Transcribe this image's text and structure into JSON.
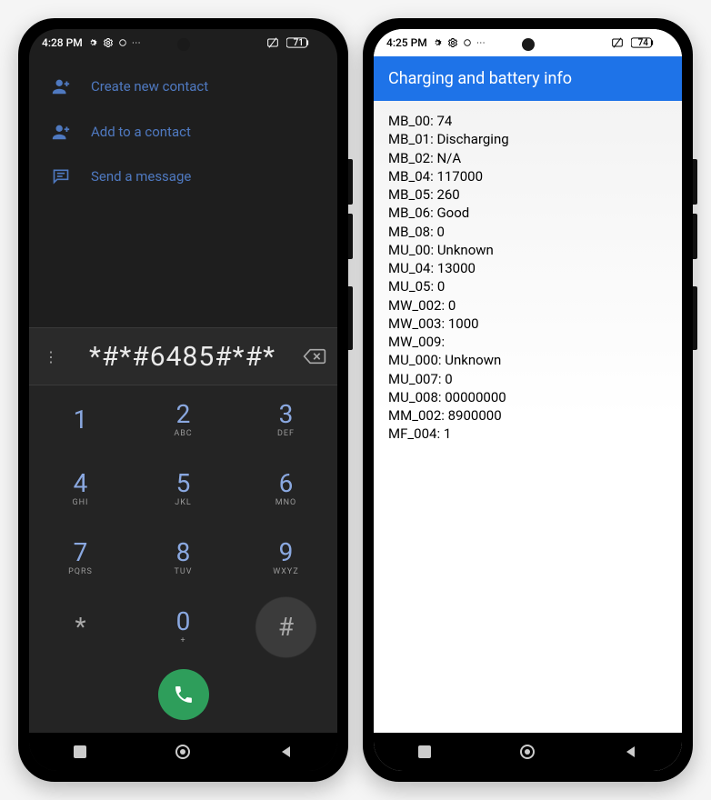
{
  "left": {
    "status": {
      "time": "4:28 PM",
      "battery": "71"
    },
    "actions": [
      {
        "icon": "person-add-icon",
        "label": "Create new contact"
      },
      {
        "icon": "person-add-icon",
        "label": "Add to a contact"
      },
      {
        "icon": "message-icon",
        "label": "Send a message"
      }
    ],
    "dial": {
      "number": "*#*#6485#*#*"
    },
    "keypad": [
      {
        "digit": "1",
        "letters": "",
        "muted": false
      },
      {
        "digit": "2",
        "letters": "ABC",
        "muted": false
      },
      {
        "digit": "3",
        "letters": "DEF",
        "muted": false
      },
      {
        "digit": "4",
        "letters": "GHI",
        "muted": false
      },
      {
        "digit": "5",
        "letters": "JKL",
        "muted": false
      },
      {
        "digit": "6",
        "letters": "MNO",
        "muted": false
      },
      {
        "digit": "7",
        "letters": "PQRS",
        "muted": false
      },
      {
        "digit": "8",
        "letters": "TUV",
        "muted": false
      },
      {
        "digit": "9",
        "letters": "WXYZ",
        "muted": false
      },
      {
        "digit": "*",
        "letters": "",
        "muted": true,
        "key": "star"
      },
      {
        "digit": "0",
        "letters": "+",
        "muted": false
      },
      {
        "digit": "#",
        "letters": "",
        "muted": true,
        "key": "hash"
      }
    ]
  },
  "right": {
    "status": {
      "time": "4:25 PM",
      "battery": "74"
    },
    "title": "Charging and battery info",
    "rows": [
      {
        "k": "MB_00",
        "v": "74"
      },
      {
        "k": "MB_01",
        "v": "Discharging"
      },
      {
        "k": "MB_02",
        "v": "N/A"
      },
      {
        "k": "MB_04",
        "v": "117000"
      },
      {
        "k": "MB_05",
        "v": "260"
      },
      {
        "k": "MB_06",
        "v": "Good"
      },
      {
        "k": "MB_08",
        "v": "0"
      },
      {
        "k": "MU_00",
        "v": "Unknown"
      },
      {
        "k": "MU_04",
        "v": "13000"
      },
      {
        "k": "MU_05",
        "v": "0"
      },
      {
        "k": "MW_002",
        "v": "0"
      },
      {
        "k": "MW_003",
        "v": "1000"
      },
      {
        "k": "MW_009",
        "v": ""
      },
      {
        "k": "MU_000",
        "v": "Unknown"
      },
      {
        "k": "MU_007",
        "v": "0"
      },
      {
        "k": "MU_008",
        "v": "00000000"
      },
      {
        "k": "MM_002",
        "v": "8900000"
      },
      {
        "k": "MF_004",
        "v": "1"
      }
    ]
  }
}
